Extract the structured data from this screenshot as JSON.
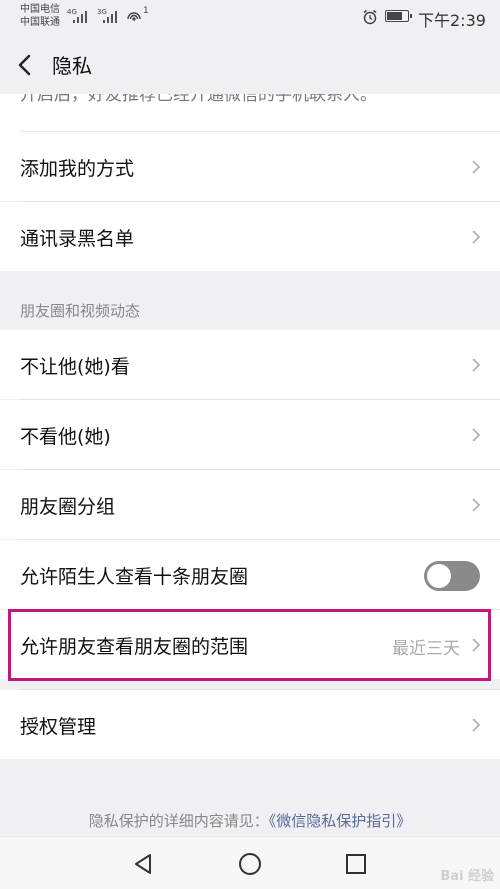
{
  "status_bar": {
    "carrier_1": "中国电信",
    "carrier_2": "中国联通",
    "signal_1": "4G",
    "signal_2": "3G",
    "hotspot_count": "1",
    "time": "下午2:39"
  },
  "header": {
    "title": "隐私"
  },
  "cut_off_text": "开启后，好友推荐已经开通微信的手机联系人。",
  "rows_top": [
    {
      "label": "添加我的方式"
    },
    {
      "label": "通讯录黑名单"
    }
  ],
  "section": {
    "title": "朋友圈和视频动态"
  },
  "rows_moments": [
    {
      "label": "不让他(她)看"
    },
    {
      "label": "不看他(她)"
    },
    {
      "label": "朋友圈分组"
    }
  ],
  "toggle_row": {
    "label": "允许陌生人查看十条朋友圈",
    "enabled": false
  },
  "range_row": {
    "label": "允许朋友查看朋友圈的范围",
    "value": "最近三天"
  },
  "auth_row": {
    "label": "授权管理"
  },
  "footer": {
    "text": "隐私保护的详细内容请见：",
    "link": "《微信隐私保护指引》"
  },
  "watermark": "Bai 经验",
  "colors": {
    "highlight_border": "#c2187a",
    "link": "#576b95",
    "toggle_off": "#8a8a8a"
  }
}
